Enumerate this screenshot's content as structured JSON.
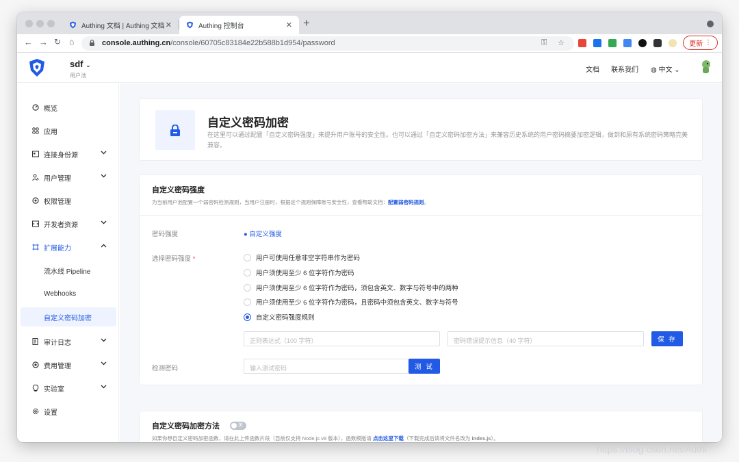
{
  "browser": {
    "tabs": [
      {
        "title": "Authing 文档 | Authing 文档",
        "active": false
      },
      {
        "title": "Authing 控制台",
        "active": true
      }
    ],
    "new_tab": "+",
    "url_host": "console.authing.cn",
    "url_path": "/console/60705c83184e22b588b1d954/password",
    "update_label": "更新"
  },
  "header": {
    "pool_name": "sdf",
    "pool_subtitle": "用户池",
    "links": {
      "docs": "文档",
      "contact": "联系我们",
      "language": "中文"
    }
  },
  "sidebar": {
    "items": [
      {
        "label": "概览",
        "icon": "dashboard-icon"
      },
      {
        "label": "应用",
        "icon": "apps-icon"
      },
      {
        "label": "连接身份源",
        "icon": "identity-icon"
      },
      {
        "label": "用户管理",
        "icon": "users-icon"
      },
      {
        "label": "权限管理",
        "icon": "permission-icon"
      },
      {
        "label": "开发者资源",
        "icon": "developer-icon"
      },
      {
        "label": "扩展能力",
        "icon": "extension-icon"
      },
      {
        "label": "流水线 Pipeline"
      },
      {
        "label": "Webhooks"
      },
      {
        "label": "自定义密码加密"
      },
      {
        "label": "审计日志",
        "icon": "audit-icon"
      },
      {
        "label": "费用管理",
        "icon": "billing-icon"
      },
      {
        "label": "实验室",
        "icon": "lab-icon"
      },
      {
        "label": "设置",
        "icon": "settings-icon"
      }
    ]
  },
  "hero": {
    "title": "自定义密码加密",
    "description": "在这里可以通过配置「自定义密码强度」来提升用户账号的安全性。也可以通过「自定义密码加密方法」来兼容历史系统的用户密码摘要加密逻辑，做到和原有系统密码策略完美兼容。"
  },
  "strength": {
    "title": "自定义密码强度",
    "desc_prefix": "为当前用户池配置一个弱密码检测规则，当用户注册时，根据这个规则保障账号安全性，查看帮助文档：",
    "desc_link": "配置弱密码规则",
    "desc_suffix": "。",
    "strength_label": "密码强度",
    "strength_value": "自定义强度",
    "choose_label": "选择密码强度",
    "required_mark": "*",
    "options": [
      "用户可使用任意非空字符串作为密码",
      "用户须使用至少 6 位字符作为密码",
      "用户须使用至少 6 位字符作为密码，须包含英文、数字与符号中的两种",
      "用户须使用至少 6 位字符作为密码，且密码中须包含英文、数字与符号",
      "自定义密码强度规则"
    ],
    "selected_index": 4,
    "regex_placeholder": "正则表达式（100 字符）",
    "error_placeholder": "密码错误提示信息（40 字符）",
    "save_label": "保 存",
    "test_label": "检测密码",
    "test_placeholder": "输入测试密码",
    "test_button": "测 试"
  },
  "encrypt": {
    "title": "自定义密码加密方法",
    "toggle_label": "关",
    "desc_prefix": "如果你想自定义密码加密函数，请在此上传函数片段（目前仅支持 Node.js v8 版本），函数模版请 ",
    "desc_link": "点击这里下载",
    "desc_mid": "（下载完成后请将文件名改为 ",
    "desc_file": "index.js",
    "desc_suffix": "）。"
  },
  "watermark": "https://blog.csdn.net/Authi",
  "colors": {
    "accent": "#215ae5",
    "active_bg": "#eef3ff"
  }
}
